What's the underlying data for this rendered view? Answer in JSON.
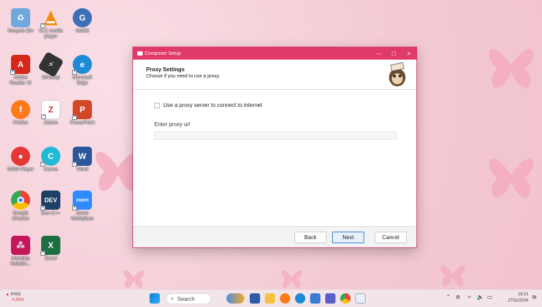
{
  "desktop": {
    "icons": [
      {
        "label": "Recycle Bin",
        "icon": "recycle-bin-icon"
      },
      {
        "label": "VLC media player",
        "icon": "vlc-icon"
      },
      {
        "label": "GNS3",
        "icon": "gns3-icon"
      },
      {
        "label": "Adobe Reader XI",
        "icon": "adobe-reader-icon"
      },
      {
        "label": "Winamp",
        "icon": "winamp-icon"
      },
      {
        "label": "Microsoft Edge",
        "icon": "edge-icon"
      },
      {
        "label": "Firefox",
        "icon": "firefox-icon"
      },
      {
        "label": "Zotero",
        "icon": "zotero-icon"
      },
      {
        "label": "PowerPoint",
        "icon": "powerpoint-icon"
      },
      {
        "label": "GOM Player",
        "icon": "gom-player-icon"
      },
      {
        "label": "Canva",
        "icon": "canva-icon"
      },
      {
        "label": "Word",
        "icon": "word-icon"
      },
      {
        "label": "Google Chrome",
        "icon": "chrome-icon"
      },
      {
        "label": "Dev-C++",
        "icon": "devcpp-icon"
      },
      {
        "label": "Zoom Workplace",
        "icon": "zoom-icon"
      },
      {
        "label": "Interplay Relaxin...",
        "icon": "interplay-icon"
      },
      {
        "label": "Excel",
        "icon": "excel-icon"
      }
    ]
  },
  "dialog": {
    "title": "Composer Setup",
    "header_title": "Proxy Settings",
    "header_subtitle": "Choose if you need to use a proxy.",
    "checkbox_label": "Use a proxy server to connect to internet",
    "url_label": "Enter proxy url",
    "url_value": "",
    "buttons": {
      "back": "Back",
      "next": "Next",
      "cancel": "Cancel"
    },
    "minimize": "—",
    "maximize": "☐",
    "close": "✕"
  },
  "taskbar": {
    "stock_name": "IHSG",
    "stock_change": "-0,93%",
    "search_placeholder": "Search",
    "time": "19:21",
    "date": "27/11/2024"
  },
  "colors": {
    "titlebar": "#e03a6a",
    "wallpaper": "#f6d3dc",
    "accent": "#2d7dd2"
  }
}
